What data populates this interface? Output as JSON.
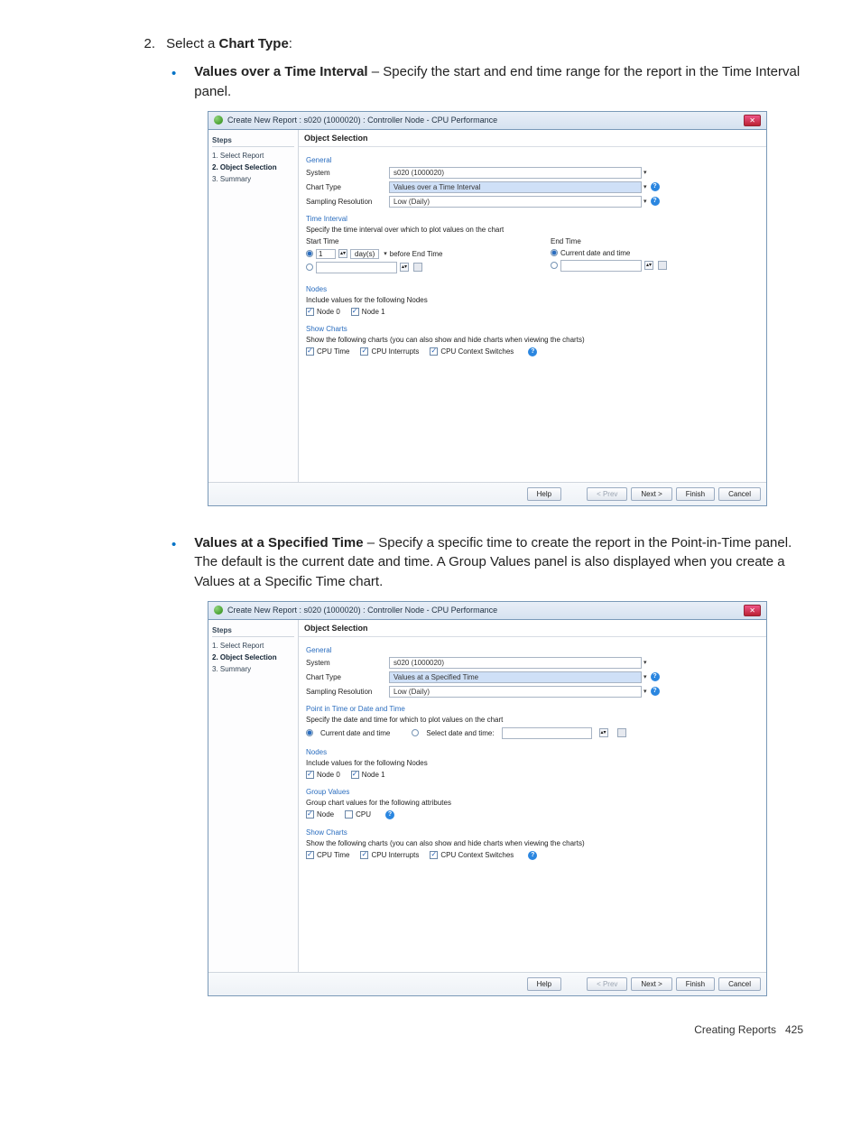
{
  "step": {
    "num": "2.",
    "text_prefix": "Select a ",
    "text_bold": "Chart Type",
    "text_suffix": ":"
  },
  "bullets": [
    {
      "title": "Values over a Time Interval",
      "body": " – Specify the start and end time range for the report in the Time Interval panel."
    },
    {
      "title": "Values at a Specified Time",
      "body": " – Specify a specific time to create the report in the Point-in-Time panel. The default is the current date and time. A Group Values panel is also displayed when you create a Values at a Specific Time chart."
    }
  ],
  "dlg_common": {
    "title": "Create New Report : s020 (1000020) : Controller Node - CPU Performance",
    "steps_h": "Steps",
    "step1": "1. Select Report",
    "step2": "2. Object Selection",
    "step3": "3. Summary",
    "main_head": "Object Selection",
    "general": "General",
    "system_lbl": "System",
    "system_val": "s020 (1000020)",
    "chart_lbl": "Chart Type",
    "sampling_lbl": "Sampling Resolution",
    "sampling_val": "Low (Daily)",
    "nodes_h": "Nodes",
    "nodes_desc": "Include values for the following Nodes",
    "node0": "Node 0",
    "node1": "Node 1",
    "show_h": "Show Charts",
    "show_desc": "Show the following charts (you can also show and hide charts when viewing the charts)",
    "ch1": "CPU Time",
    "ch2": "CPU Interrupts",
    "ch3": "CPU Context Switches",
    "btn_help": "Help",
    "btn_prev": "< Prev",
    "btn_next": "Next >",
    "btn_finish": "Finish",
    "btn_cancel": "Cancel"
  },
  "dlg1": {
    "chart_type": "Values over a Time Interval",
    "ti_h": "Time Interval",
    "ti_desc": "Specify the time interval over which to plot values on the chart",
    "start_h": "Start Time",
    "end_h": "End Time",
    "relative_num": "1",
    "relative_unit": "day(s)",
    "relative_suffix": "before End Time",
    "current": "Current date and time"
  },
  "dlg2": {
    "chart_type": "Values at a Specified Time",
    "pt_h": "Point in Time or Date and Time",
    "pt_desc": "Specify the date and time for which to plot values on the chart",
    "opt_current": "Current date and time",
    "opt_select": "Select date and time:",
    "gv_h": "Group Values",
    "gv_desc": "Group chart values for the following attributes",
    "gv_node": "Node",
    "gv_cpu": "CPU"
  },
  "footer": {
    "label": "Creating Reports",
    "page": "425"
  }
}
